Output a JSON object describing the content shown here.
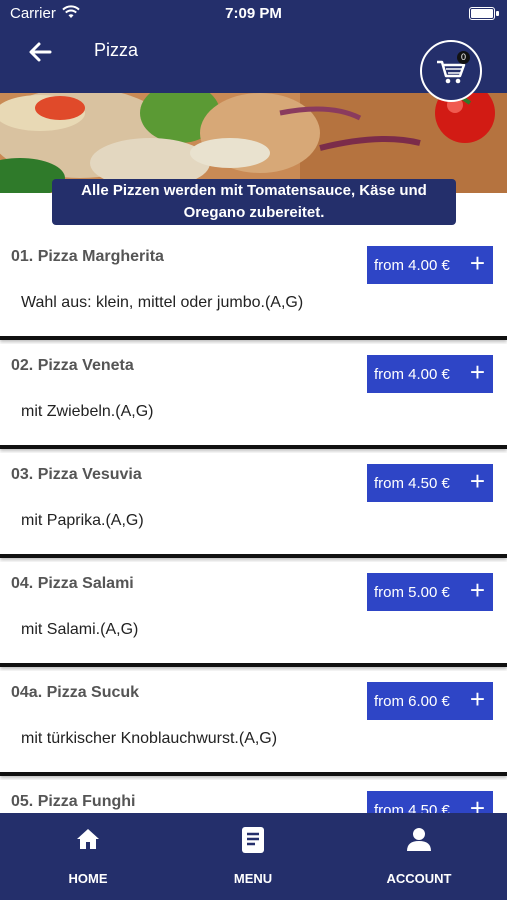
{
  "status_bar": {
    "carrier": "Carrier",
    "time": "7:09 PM"
  },
  "nav": {
    "title": "Pizza",
    "cart_count": "0"
  },
  "banner_notice": "Alle Pizzen werden mit Tomatensauce, Käse und Oregano zubereitet.",
  "items": [
    {
      "name": "01. Pizza Margherita",
      "description": "Wahl aus: klein, mittel oder jumbo.(A,G)",
      "price": "from 4.00 €"
    },
    {
      "name": "02. Pizza Veneta",
      "description": "mit Zwiebeln.(A,G)",
      "price": "from 4.00 €"
    },
    {
      "name": "03. Pizza Vesuvia",
      "description": "mit Paprika.(A,G)",
      "price": "from 4.50 €"
    },
    {
      "name": "04. Pizza Salami",
      "description": "mit Salami.(A,G)",
      "price": "from 5.00 €"
    },
    {
      "name": "04a. Pizza Sucuk",
      "description": "mit türkischer Knoblauchwurst.(A,G)",
      "price": "from 6.00 €"
    },
    {
      "name": "05. Pizza Funghi",
      "description": "",
      "price": "from 4.50 €"
    }
  ],
  "tabbar": {
    "home": "HOME",
    "menu": "MENU",
    "account": "ACCOUNT"
  },
  "colors": {
    "primary": "#242f6b",
    "button": "#2e45c6"
  }
}
